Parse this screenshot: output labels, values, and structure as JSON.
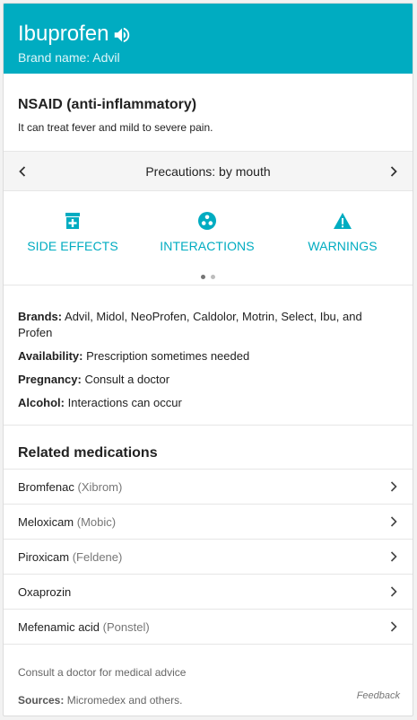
{
  "header": {
    "title": "Ibuprofen",
    "brand_name": "Brand name: Advil",
    "accent_color": "#00acc1"
  },
  "drug_class": {
    "title": "NSAID (anti-inflammatory)",
    "description": "It can treat fever and mild to severe pain."
  },
  "pager": {
    "title": "Precautions: by mouth",
    "prev_icon": "chevron-left-icon",
    "next_icon": "chevron-right-icon",
    "page": 1,
    "page_count": 2
  },
  "tiles": [
    {
      "label": "SIDE EFFECTS",
      "icon": "pill-bottle-plus-icon"
    },
    {
      "label": "INTERACTIONS",
      "icon": "interactions-icon"
    },
    {
      "label": "WARNINGS",
      "icon": "warning-icon"
    }
  ],
  "facts": {
    "brands_label": "Brands:",
    "brands_value": "Advil, Midol, NeoProfen, Caldolor, Motrin, Select, Ibu, and Profen",
    "availability_label": "Availability:",
    "availability_value": "Prescription sometimes needed",
    "pregnancy_label": "Pregnancy:",
    "pregnancy_value": "Consult a doctor",
    "alcohol_label": "Alcohol:",
    "alcohol_value": "Interactions can occur"
  },
  "related": {
    "title": "Related medications",
    "items": [
      {
        "name": "Bromfenac",
        "brand": "(Xibrom)"
      },
      {
        "name": "Meloxicam",
        "brand": "(Mobic)"
      },
      {
        "name": "Piroxicam",
        "brand": "(Feldene)"
      },
      {
        "name": "Oxaprozin",
        "brand": ""
      },
      {
        "name": "Mefenamic acid",
        "brand": "(Ponstel)"
      }
    ]
  },
  "footer": {
    "advice": "Consult a doctor for medical advice",
    "sources_label": "Sources:",
    "sources_value": "Micromedex and others.",
    "feedback": "Feedback"
  }
}
